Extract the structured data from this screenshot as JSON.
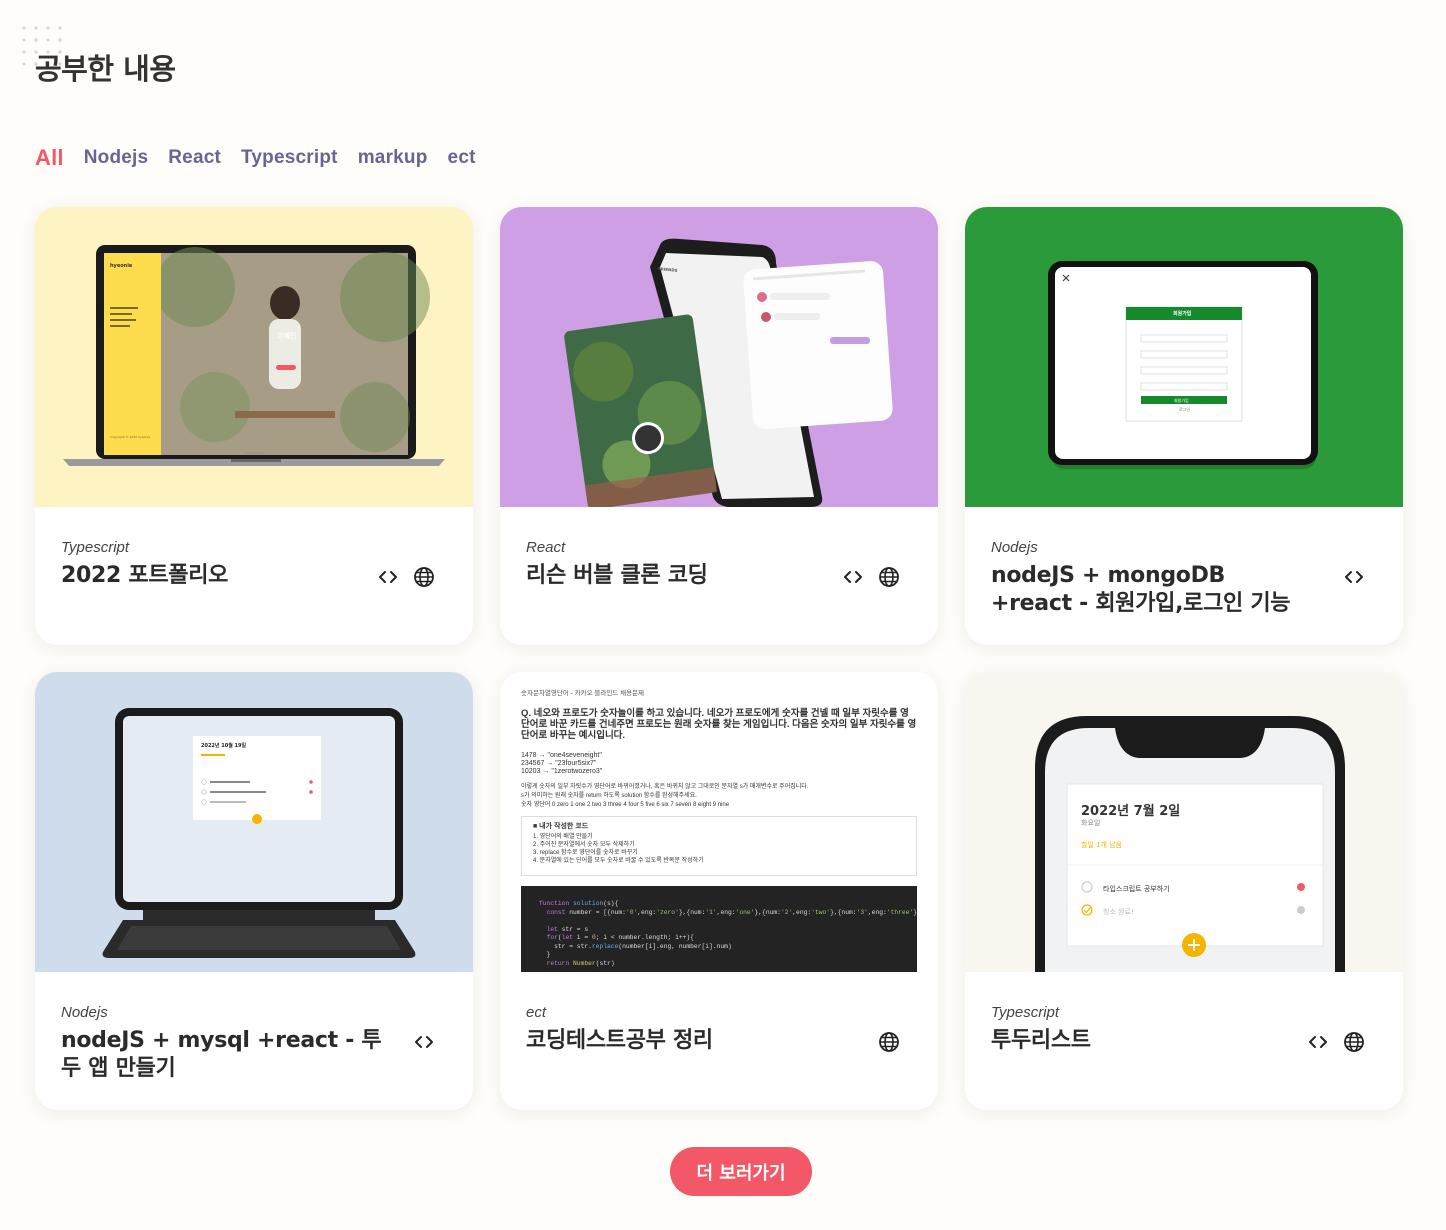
{
  "section_title": "공부한 내용",
  "tabs": [
    "All",
    "Nodejs",
    "React",
    "Typescript",
    "markup",
    "ect"
  ],
  "cards": [
    {
      "category": "Typescript",
      "title": "2022 포트폴리오"
    },
    {
      "category": "React",
      "title": "리슨 버블 클론 코딩"
    },
    {
      "category": "Nodejs",
      "title": "nodeJS + mongoDB +react - 회원가입,로그인 기능"
    },
    {
      "category": "Nodejs",
      "title": "nodeJS + mysql +react - 투두 앱 만들기"
    },
    {
      "category": "ect",
      "title": "코딩테스트공부 정리"
    },
    {
      "category": "Typescript",
      "title": "투두리스트"
    }
  ],
  "more_button": "더 보러가기",
  "thumbs": {
    "portfolio": {
      "brand": "hyeonie",
      "name": "고혜인",
      "footer": "Copyright © 2022 hyeonie",
      "device": "MacBook Pro"
    },
    "bubble": {
      "friends": "FRIENDS"
    },
    "signup": {
      "header": "회원가입",
      "submit": "회원가입",
      "login": "로그인"
    },
    "todo_ipad": {
      "date": "2022년 10월 19일"
    },
    "codetest": {
      "caption": "숫자문자열영단어 - 카카오 블라인드 채용문제",
      "question": "Q. 네오와 프로도가 숫자놀이를 하고 있습니다. 네오가 프로도에게 숫자를 건넬 때 일부 자릿수를 영단어로 바꾼 카드를 건네주면 프로도는 원래 숫자를 찾는 게임입니다. 다음은 숫자의 일부 자릿수를 영단어로 바꾸는 예시입니다.",
      "examples": [
        "1478 → \"one4seveneight\"",
        "234567 → \"23four5six7\"",
        "10203 → \"1zerotwozero3\""
      ],
      "desc": [
        "이렇게 숫자의 일부 자릿수가 영단어로 바뀌어졌거나, 혹은 바뀌지 않고 그대로인 문자열 s가 매개변수로 주어집니다.",
        "s가 의미하는 원래 숫자를 return 하도록 solution 함수를 완성해주세요.",
        "숫자 영단어 0 zero 1 one 2 two 3 three 4 four 5 five 6 six 7 seven 8 eight 9 nine"
      ],
      "my_code_title": "■ 내가 작성한 코드",
      "steps": [
        "1. 영단어의 배열 만들기",
        "2. 주어진 문자열에서 숫자 모두 삭제하기",
        "3. replace 함수로 영단어를 숫자로 바꾸기",
        "4. 문자열에 있는 단어를 모두 숫자로 바꿀 수 있도록 반복문 작성하기"
      ]
    },
    "todo_phone": {
      "date": "2022년 7월 2일",
      "day": "화요일",
      "count": "할일 1개 남음",
      "item1": "타입스크립트 공부하기",
      "item2": "청소 완료!"
    }
  }
}
